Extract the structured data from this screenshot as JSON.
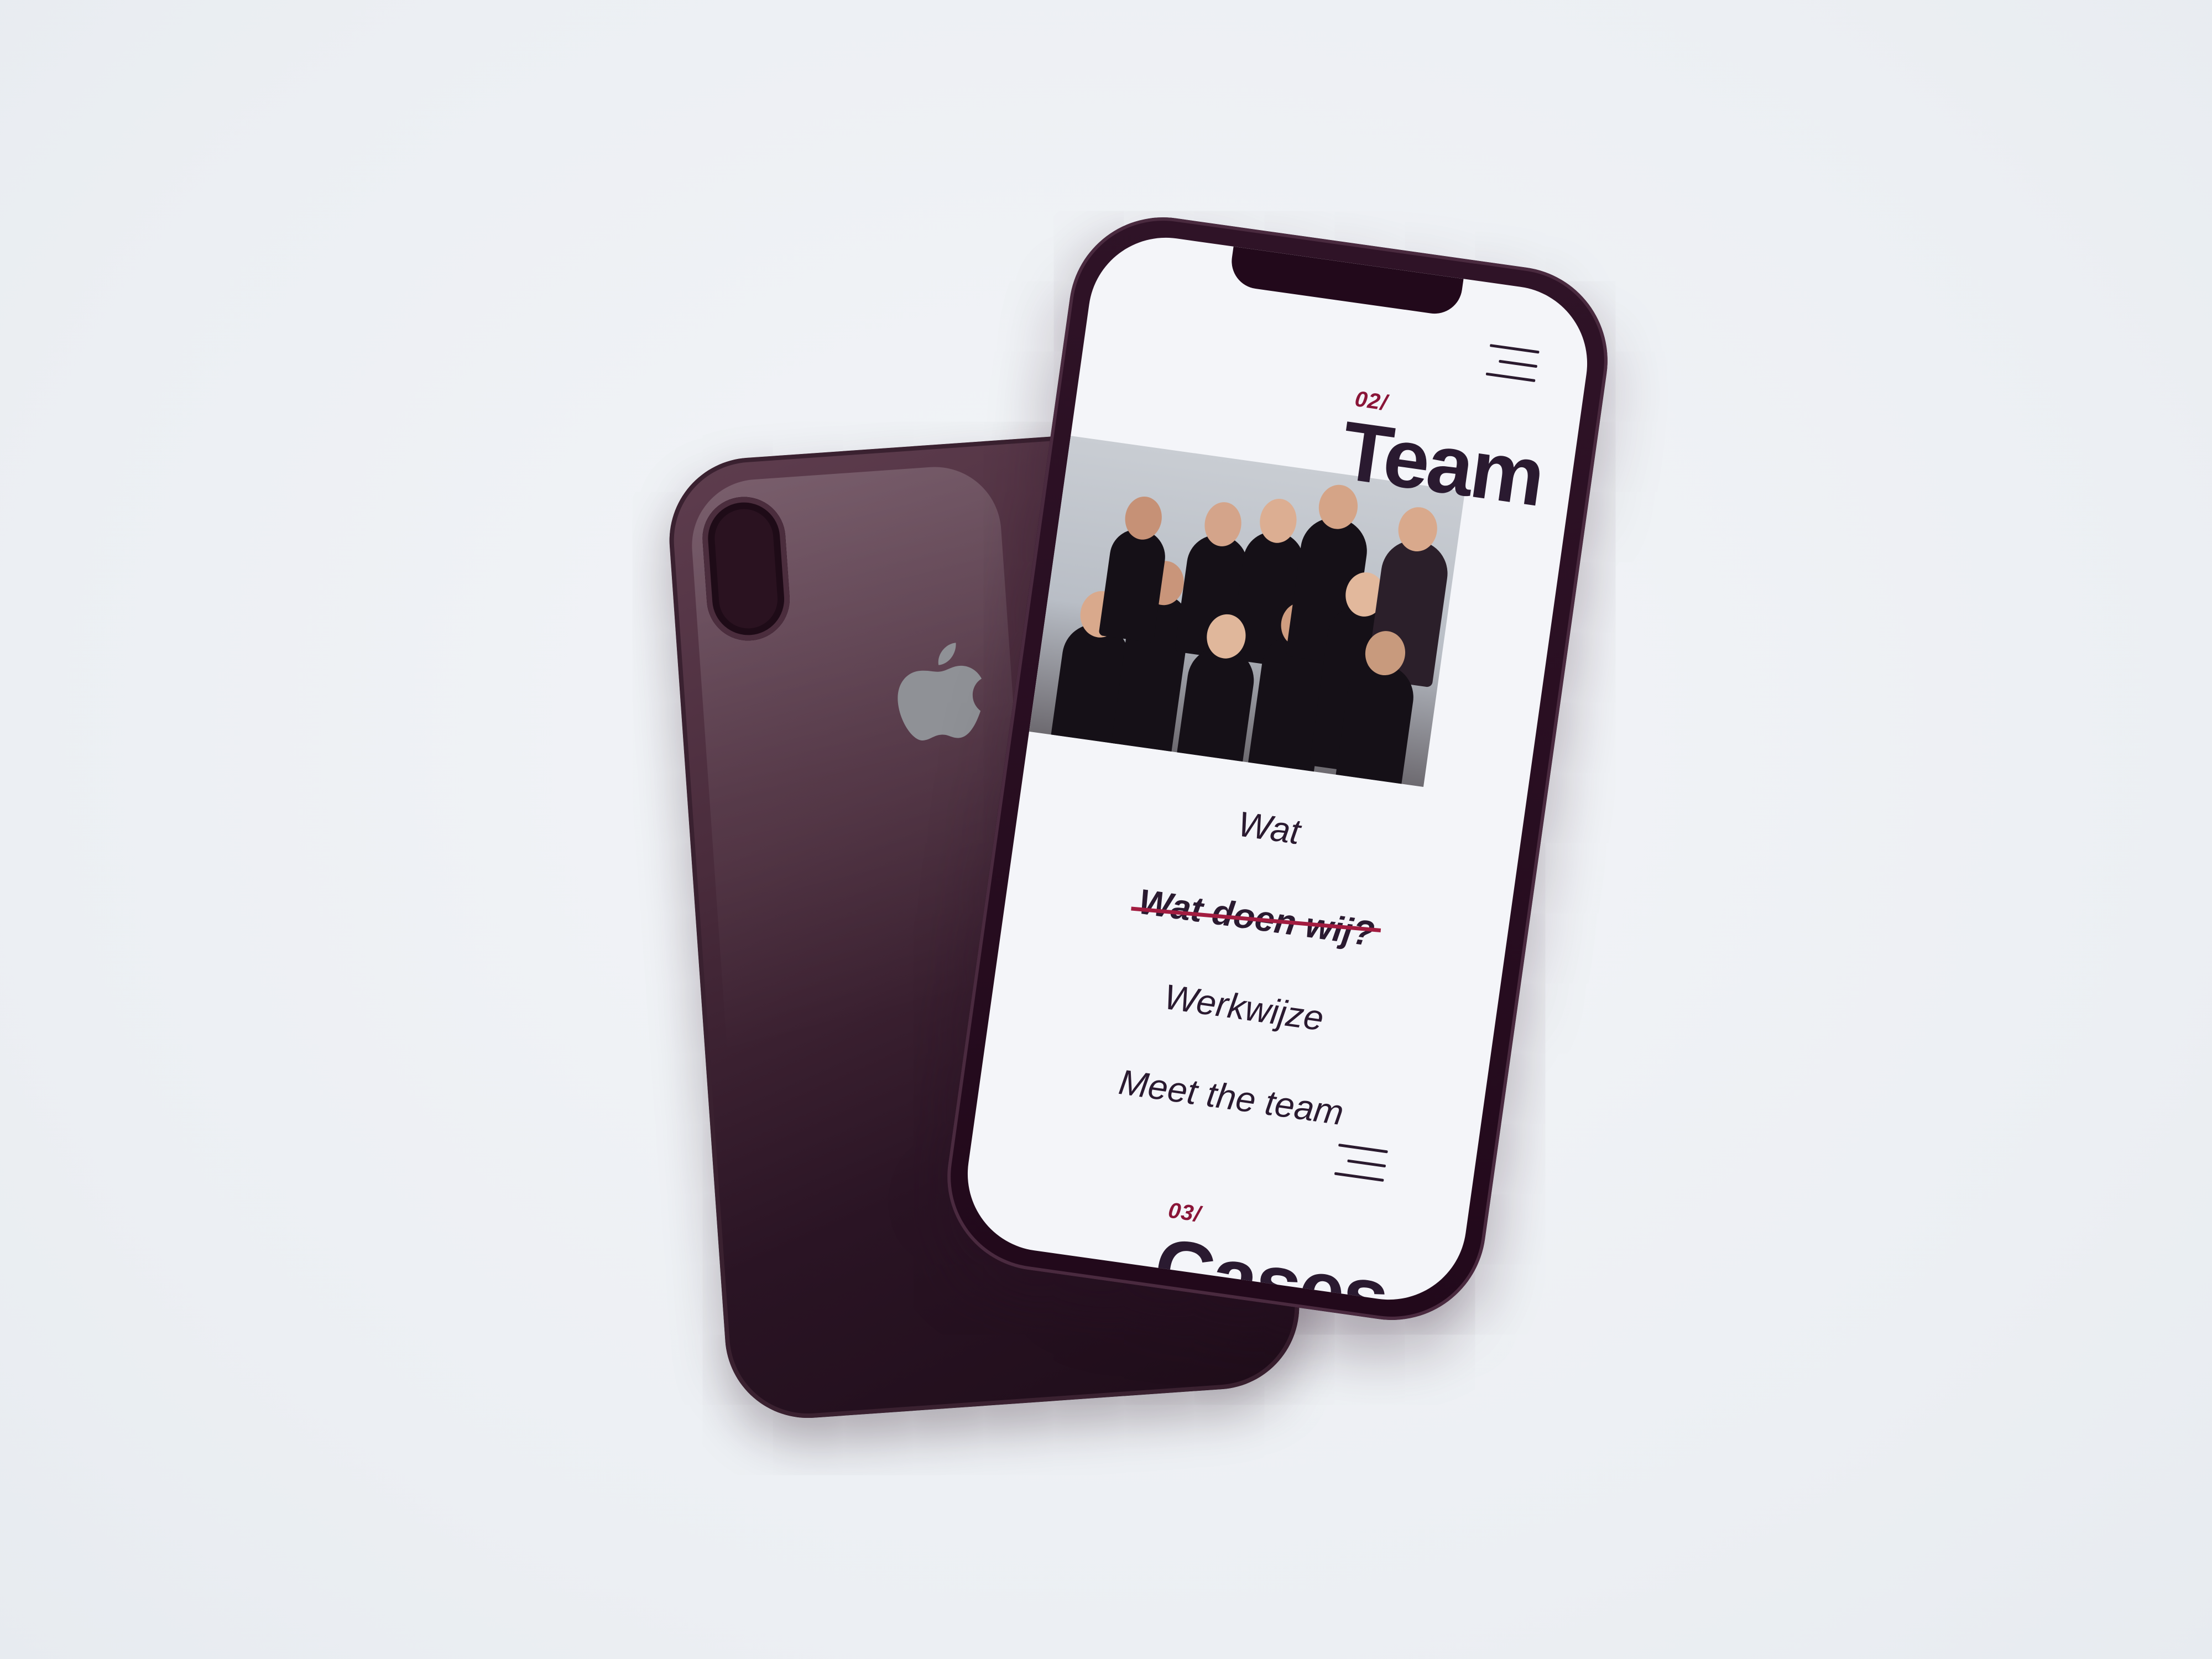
{
  "back_phone": {
    "logo_icon": "apple-logo-icon",
    "camera_icon": "dual-camera-icon"
  },
  "front_phone": {
    "menu_icon": "hamburger-menu-icon",
    "sections": [
      {
        "number": "02/",
        "title": "Team"
      },
      {
        "number": "03/",
        "title": "Cases"
      }
    ],
    "nav": [
      {
        "label": "Wat",
        "active": false
      },
      {
        "label": "Wat doen wij?",
        "active": true
      },
      {
        "label": "Werkwijze",
        "active": false
      },
      {
        "label": "Meet the team",
        "active": false
      }
    ]
  },
  "colors": {
    "accent": "#a21c40",
    "section_number": "#8a1538",
    "text": "#2a1a30",
    "background": "#eef1f5",
    "phone_body": "#22091b"
  }
}
